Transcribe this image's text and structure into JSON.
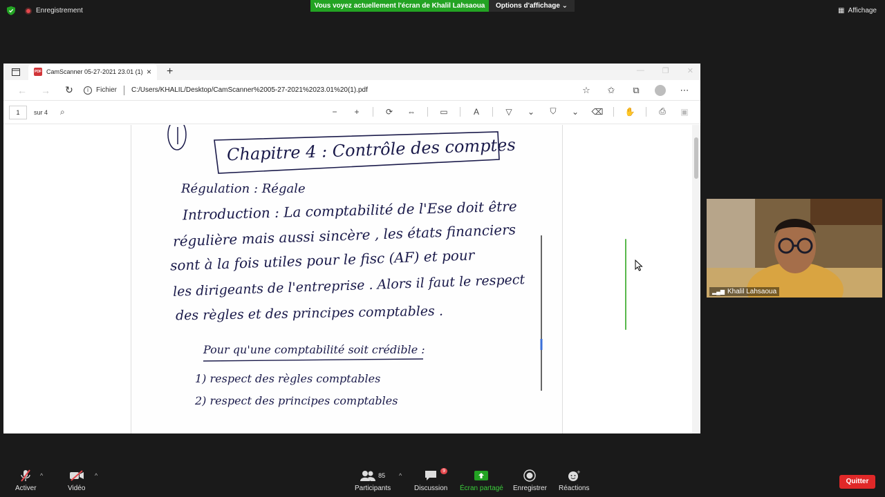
{
  "zoom": {
    "recording_label": "Enregistrement",
    "share_banner": "Vous voyez actuellement l'écran de Khalil Lahsaoua",
    "view_options": "Options d'affichage",
    "view_label": "Affichage",
    "participant_name": "Khalil Lahsaoua",
    "controls": {
      "mute": "Activer",
      "video": "Vidéo",
      "participants": "Participants",
      "participants_count": "85",
      "chat": "Discussion",
      "chat_badge": "9",
      "share": "Écran partagé",
      "record": "Enregistrer",
      "reactions": "Réactions",
      "quit": "Quitter"
    },
    "colors": {
      "share_green": "#23a323",
      "quit_red": "#e02828"
    }
  },
  "browser": {
    "tab_title": "CamScanner 05-27-2021 23.01 (1)",
    "info_label": "Fichier",
    "url": "C:/Users/KHALIL/Desktop/CamScanner%2005-27-2021%2023.01%20(1).pdf"
  },
  "pdf": {
    "page_current": "1",
    "page_total": "sur 4"
  },
  "document": {
    "chapter_title": "Chapitre 4 : Contrôle des comptes",
    "line1": "Régulation : Régale",
    "line2": "Introduction : La comptabilité de l'Ese doit être",
    "line3": "régulière mais aussi sincère , les états financiers",
    "line4": "sont à la fois utiles pour le fisc (AF) et pour",
    "line5": "les dirigeants de l'entreprise . Alors il faut le respect",
    "line6": "des règles et des principes comptables .",
    "subtitle": "Pour qu'une comptabilité soit crédible :",
    "item1": "1) respect des règles comptables",
    "item2": "2) respect des principes comptables"
  }
}
